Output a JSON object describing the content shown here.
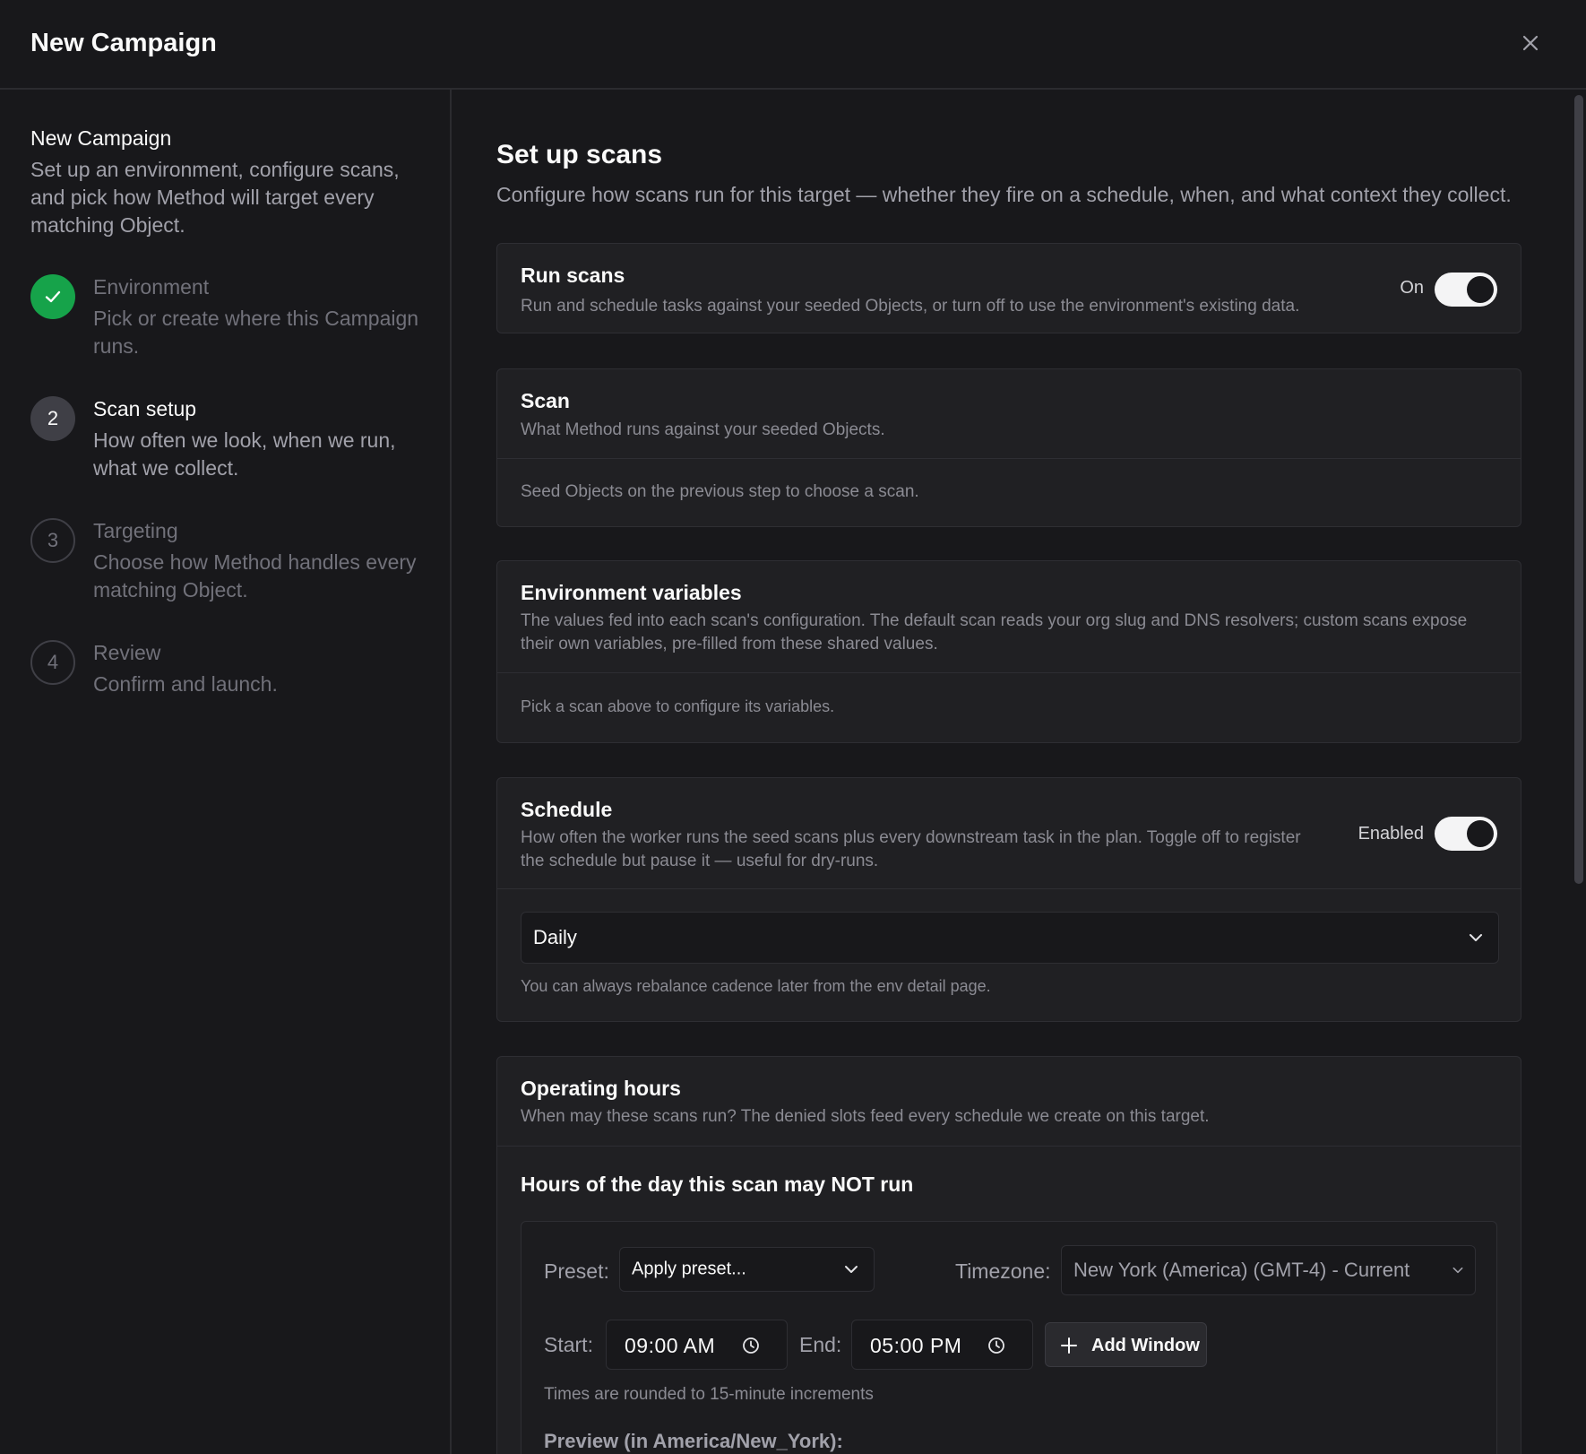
{
  "dialog": {
    "title": "New Campaign"
  },
  "sidebar": {
    "title": "New Campaign",
    "description": "Set up an environment, configure scans, and pick how Method will target every matching Object.",
    "steps": [
      {
        "number": "",
        "status": "done",
        "title": "Environment",
        "description": "Pick or create where this Campaign runs."
      },
      {
        "number": "2",
        "status": "active",
        "title": "Scan setup",
        "description": "How often we look, when we run, what we collect."
      },
      {
        "number": "3",
        "status": "pending",
        "title": "Targeting",
        "description": "Choose how Method handles every matching Object."
      },
      {
        "number": "4",
        "status": "pending",
        "title": "Review",
        "description": "Confirm and launch."
      }
    ]
  },
  "main": {
    "title": "Set up scans",
    "lead": "Configure how scans run for this target — whether they fire on a schedule, when, and what context they collect.",
    "run_scans": {
      "title": "Run scans",
      "description": "Run and schedule tasks against your seeded Objects, or turn off to use the environment's existing data.",
      "toggle_label": "On",
      "enabled": true
    },
    "scan": {
      "title": "Scan",
      "description": "What Method runs against your seeded Objects.",
      "note": "Seed Objects on the previous step to choose a scan."
    },
    "env_vars": {
      "title": "Environment variables",
      "description": "The values fed into each scan's configuration. The default scan reads your org slug and DNS resolvers; custom scans expose their own variables, pre-filled from these shared values.",
      "note": "Pick a scan above to configure its variables."
    },
    "schedule": {
      "title": "Schedule",
      "description": "How often the worker runs the seed scans plus every downstream task in the plan. Toggle off to register the schedule but pause it — useful for dry-runs.",
      "toggle_label": "Enabled",
      "enabled": true,
      "frequency": "Daily",
      "note": "You can always rebalance cadence later from the env detail page."
    },
    "operating_hours": {
      "title": "Operating hours",
      "description": "When may these scans run? The denied slots feed every schedule we create on this target.",
      "section_title": "Hours of the day this scan may NOT run",
      "preset_label": "Preset:",
      "preset_value": "Apply preset...",
      "timezone_label": "Timezone:",
      "timezone_value": "New York (America) (GMT-4) - Current",
      "start_label": "Start:",
      "start_value": "09:00  AM",
      "end_label": "End:",
      "end_value": "05:00  PM",
      "add_window": "Add Window",
      "rounding_note": "Times are rounded to 15-minute increments",
      "preview_label": "Preview (in America/New_York):"
    }
  }
}
